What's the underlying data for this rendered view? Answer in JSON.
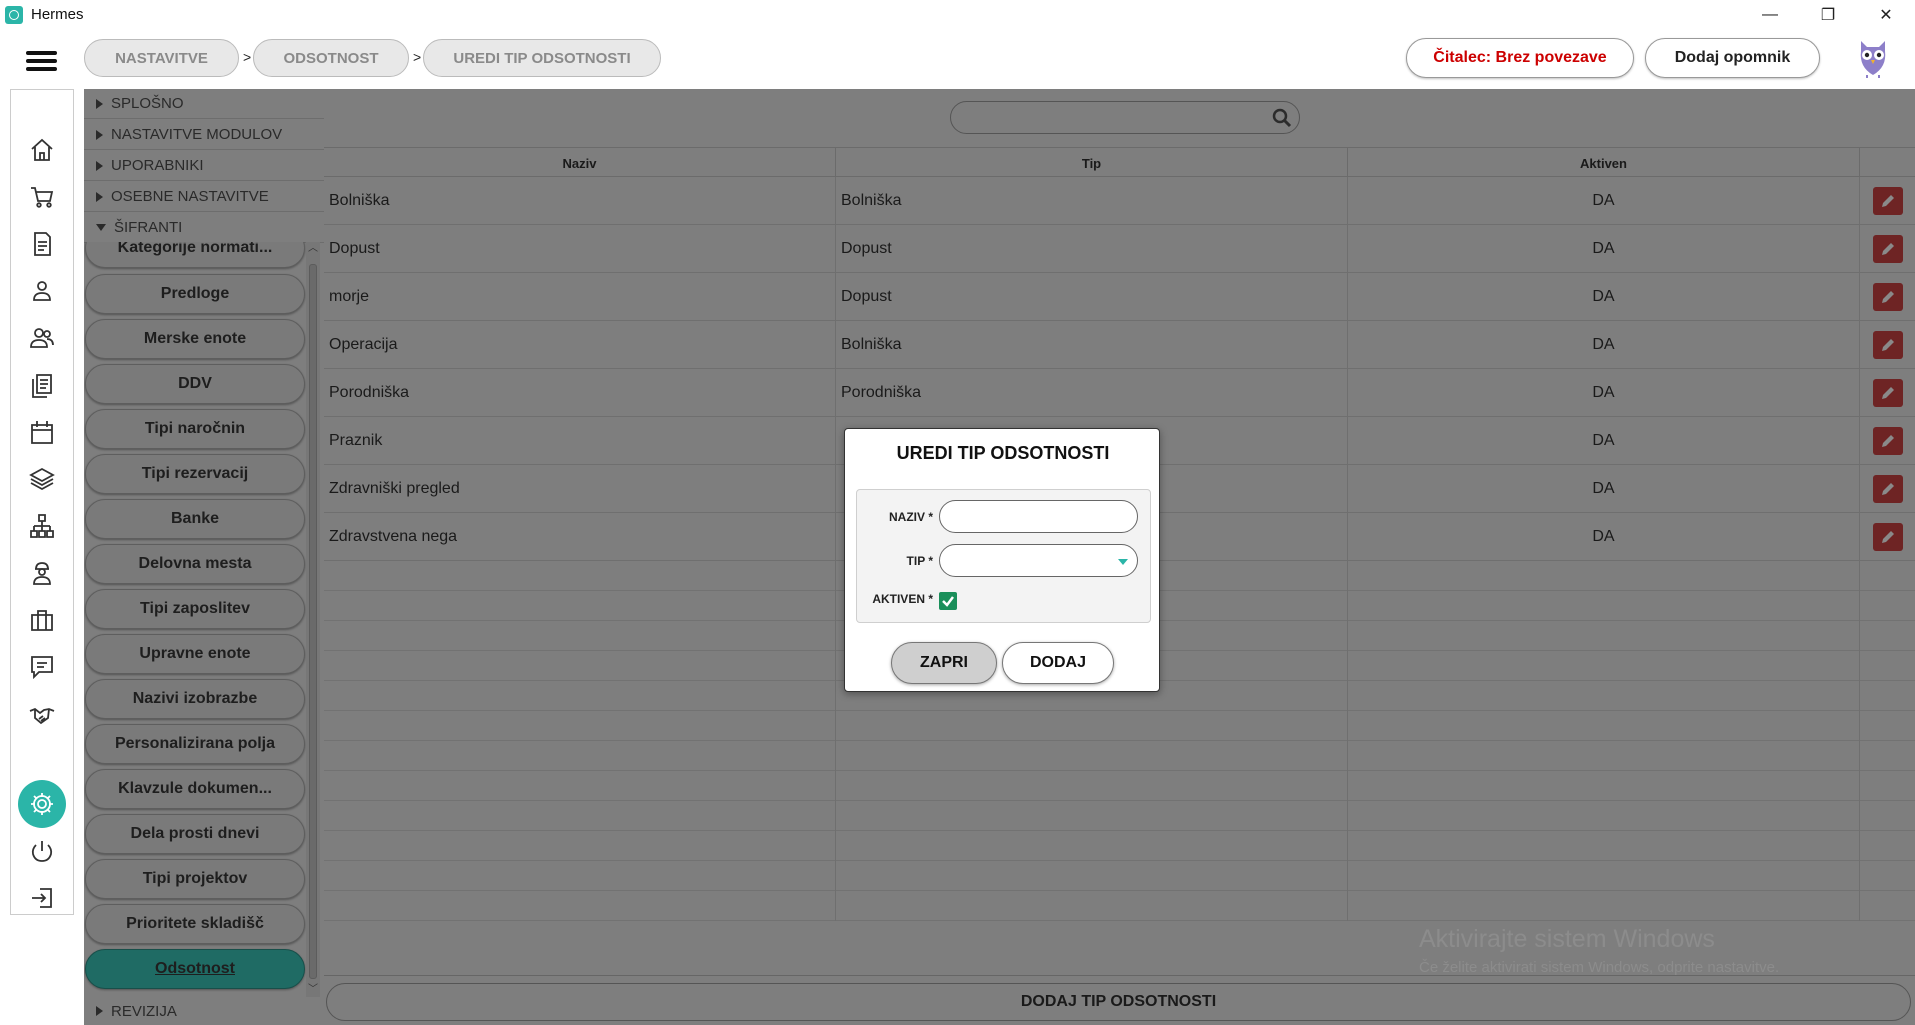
{
  "window": {
    "title": "Hermes",
    "controls": {
      "minimize": "—",
      "maximize": "❐",
      "close": "✕"
    }
  },
  "breadcrumb": [
    "NASTAVITVE",
    "ODSOTNOST",
    "UREDI TIP ODSOTNOSTI"
  ],
  "breadcrumb_sep": ">",
  "header": {
    "reader_status": "Čitalec: Brez povezave",
    "reader_status_color": "#cc0000",
    "add_reminder": "Dodaj opomnik"
  },
  "icon_sidebar": [
    "home-icon",
    "cart-icon",
    "document-icon",
    "user-icon",
    "users-icon",
    "documents-icon",
    "calendar-icon",
    "layers-icon",
    "network-icon",
    "worker-icon",
    "briefcase-icon",
    "chat-icon",
    "handshake-icon",
    "gear-icon",
    "power-icon",
    "logout-icon"
  ],
  "settings_sections": {
    "splosno": "SPLOŠNO",
    "nastavitve_modulov": "NASTAVITVE MODULOV",
    "uporabniki": "UPORABNIKI",
    "osebne_nastavitve": "OSEBNE NASTAVITVE",
    "sifranti": "ŠIFRANTI",
    "revizija": "REVIZIJA"
  },
  "sifranti_items": [
    "Kategorije normati...",
    "Predloge",
    "Merske enote",
    "DDV",
    "Tipi naročnin",
    "Tipi rezervacij",
    "Banke",
    "Delovna mesta",
    "Tipi zaposlitev",
    "Upravne enote",
    "Nazivi izobrazbe",
    "Personalizirana polja",
    "Klavzule dokumen...",
    "Dela prosti dnevi",
    "Tipi projektov",
    "Prioritete skladišč",
    "Odsotnost"
  ],
  "active_item": "Odsotnost",
  "search": {
    "placeholder": ""
  },
  "table": {
    "columns": [
      "Naziv",
      "Tip",
      "Aktiven"
    ],
    "rows": [
      [
        "Bolniška",
        "Bolniška",
        "DA"
      ],
      [
        "Dopust",
        "Dopust",
        "DA"
      ],
      [
        "morje",
        "Dopust",
        "DA"
      ],
      [
        "Operacija",
        "Bolniška",
        "DA"
      ],
      [
        "Porodniška",
        "Porodniška",
        "DA"
      ],
      [
        "Praznik",
        "",
        "DA"
      ],
      [
        "Zdravniški pregled",
        "",
        "DA"
      ],
      [
        "Zdravstvena nega",
        "",
        "DA"
      ]
    ]
  },
  "add_button": "DODAJ TIP ODSOTNOSTI",
  "watermark": {
    "line1": "Aktivirajte sistem Windows",
    "line2": "Če želite aktivirati sistem Windows, odprite nastavitve."
  },
  "modal": {
    "title": "UREDI TIP ODSOTNOSTI",
    "naziv_label": "NAZIV *",
    "naziv_value": "",
    "tip_label": "TIP *",
    "tip_value": "",
    "aktiven_label": "AKTIVEN *",
    "aktiven_checked": true,
    "close_button": "ZAPRI",
    "add_button": "DODAJ"
  },
  "colors": {
    "accent": "#2bb5a8",
    "active_item": "#1f6b64",
    "overlay_gray": "#7e7e7e",
    "edit_button": "#6e2424"
  }
}
